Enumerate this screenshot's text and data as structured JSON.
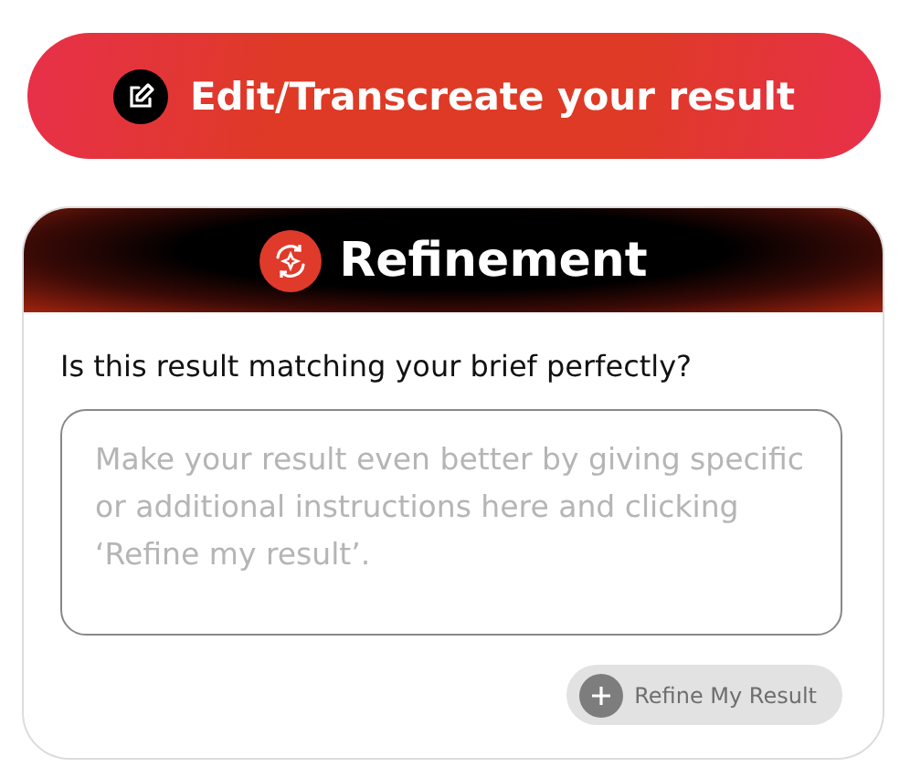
{
  "edit_button": {
    "label": "Edit/Transcreate your result"
  },
  "refinement": {
    "title": "Refinement",
    "question": "Is this result matching your brief perfectly?",
    "input": {
      "placeholder": "Make your result even better by giving specific or additional instructions here and clicking ‘Refine my result’."
    },
    "refine_button": {
      "label": "Refine My Result",
      "disabled": true
    }
  }
}
